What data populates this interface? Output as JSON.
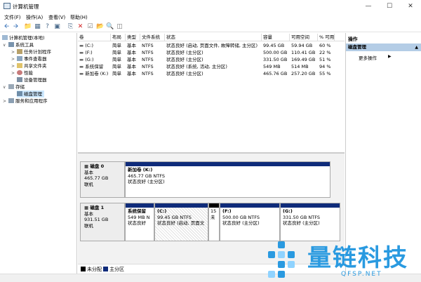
{
  "window": {
    "title": "计算机管理"
  },
  "menu": [
    "文件(F)",
    "操作(A)",
    "查看(V)",
    "帮助(H)"
  ],
  "tree": {
    "root": "计算机管理(本地)",
    "system_tools": "系统工具",
    "task_scheduler": "任务计划程序",
    "event_viewer": "事件查看器",
    "shared_folders": "共享文件夹",
    "performance": "性能",
    "device_manager": "设备管理器",
    "storage": "存储",
    "disk_management": "磁盘管理",
    "services": "服务和应用程序"
  },
  "columns": [
    "卷",
    "布局",
    "类型",
    "文件系统",
    "状态",
    "容量",
    "可用空间",
    "% 可用"
  ],
  "volumes": [
    {
      "name": "(C:)",
      "layout": "简单",
      "type": "基本",
      "fs": "NTFS",
      "status": "状态良好 (启动, 页面文件, 故障转储, 主分区)",
      "capacity": "99.45 GB",
      "free": "59.94 GB",
      "pct": "60 %"
    },
    {
      "name": "(F:)",
      "layout": "简单",
      "type": "基本",
      "fs": "NTFS",
      "status": "状态良好 (主分区)",
      "capacity": "500.00 GB",
      "free": "110.41 GB",
      "pct": "22 %"
    },
    {
      "name": "(G:)",
      "layout": "简单",
      "type": "基本",
      "fs": "NTFS",
      "status": "状态良好 (主分区)",
      "capacity": "331.50 GB",
      "free": "169.49 GB",
      "pct": "51 %"
    },
    {
      "name": "系统保留",
      "layout": "简单",
      "type": "基本",
      "fs": "NTFS",
      "status": "状态良好 (系统, 活动, 主分区)",
      "capacity": "549 MB",
      "free": "514 MB",
      "pct": "94 %"
    },
    {
      "name": "新加卷 (K:)",
      "layout": "简单",
      "type": "基本",
      "fs": "NTFS",
      "status": "状态良好 (主分区)",
      "capacity": "465.76 GB",
      "free": "257.20 GB",
      "pct": "55 %"
    }
  ],
  "disk0": {
    "label": "磁盘 0",
    "type": "基本",
    "size": "465.77 GB",
    "state": "联机",
    "partitions": [
      {
        "name": "新加卷 (K:)",
        "size": "465.77 GB NTFS",
        "status": "状态良好 (主分区)"
      }
    ]
  },
  "disk1": {
    "label": "磁盘 1",
    "type": "基本",
    "size": "931.51 GB",
    "state": "联机",
    "partitions": [
      {
        "name": "系统保留",
        "size": "549 MB N",
        "status": "状态良好"
      },
      {
        "name": "(C:)",
        "size": "99.45 GB NTFS",
        "status": "状态良好 (启动, 页面文"
      },
      {
        "name": "",
        "size": "15",
        "status": "未"
      },
      {
        "name": "(F:)",
        "size": "500.00 GB NTFS",
        "status": "状态良好 (主分区)"
      },
      {
        "name": "(G:)",
        "size": "331.50 GB NTFS",
        "status": "状态良好 (主分区)"
      }
    ]
  },
  "legend": {
    "unallocated": "未分配",
    "primary": "主分区"
  },
  "actions": {
    "header": "操作",
    "section": "磁盘管理",
    "more": "更多操作"
  },
  "watermark": {
    "brand": "量链科技",
    "url": "QFSP.NET"
  },
  "colors": {
    "primary_partition": "#0f2b7a",
    "unallocated": "#000000",
    "selected": "#cce8ff",
    "actions_section": "#b4cde6",
    "watermark": "#2a9ae0"
  }
}
